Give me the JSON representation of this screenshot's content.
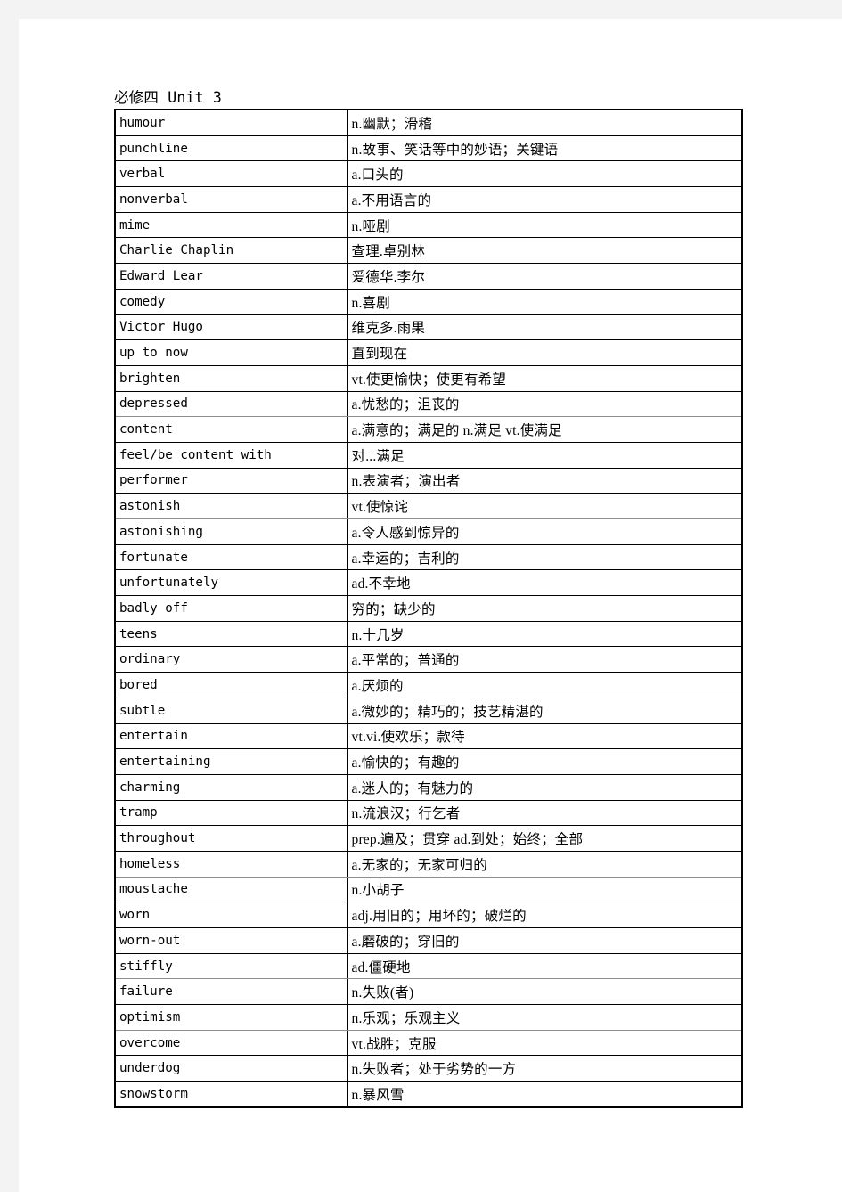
{
  "document": {
    "title": "必修四 Unit 3",
    "page_background": "#ffffff",
    "margin_background": "#f3f3f4",
    "text_color": "#000000",
    "border_color": "#000000"
  },
  "table": {
    "columns": [
      "word",
      "definition"
    ],
    "rows": [
      {
        "word": "humour",
        "definition": "n.幽默；滑稽"
      },
      {
        "word": "punchline",
        "definition": "n.故事、笑话等中的妙语；关键语"
      },
      {
        "word": "verbal",
        "definition": "a.口头的"
      },
      {
        "word": "nonverbal",
        "definition": "a.不用语言的"
      },
      {
        "word": "mime",
        "definition": "n.哑剧"
      },
      {
        "word": "Charlie Chaplin",
        "definition": "查理.卓别林"
      },
      {
        "word": "Edward Lear",
        "definition": "爱德华.李尔"
      },
      {
        "word": "comedy",
        "definition": "n.喜剧"
      },
      {
        "word": "Victor Hugo",
        "definition": "维克多.雨果"
      },
      {
        "word": "up to now",
        "definition": "直到现在"
      },
      {
        "word": "brighten",
        "definition": "vt.使更愉快；使更有希望"
      },
      {
        "word": "depressed",
        "definition": "a.忧愁的；沮丧的"
      },
      {
        "word": "content",
        "definition": "a.满意的；满足的 n.满足 vt.使满足"
      },
      {
        "word": "feel/be content with",
        "definition": "对...满足"
      },
      {
        "word": "performer",
        "definition": "n.表演者；演出者"
      },
      {
        "word": "astonish",
        "definition": "vt.使惊诧"
      },
      {
        "word": "astonishing",
        "definition": "a.令人感到惊异的"
      },
      {
        "word": "fortunate",
        "definition": "a.幸运的；吉利的"
      },
      {
        "word": "unfortunately",
        "definition": "ad.不幸地"
      },
      {
        "word": "badly off",
        "definition": "穷的；缺少的"
      },
      {
        "word": "teens",
        "definition": "n.十几岁"
      },
      {
        "word": "ordinary",
        "definition": "a.平常的；普通的"
      },
      {
        "word": "bored",
        "definition": "a.厌烦的"
      },
      {
        "word": "subtle",
        "definition": "a.微妙的；精巧的；技艺精湛的"
      },
      {
        "word": "entertain",
        "definition": "vt.vi.使欢乐；款待"
      },
      {
        "word": "entertaining",
        "definition": "a.愉快的；有趣的"
      },
      {
        "word": "charming",
        "definition": "a.迷人的；有魅力的"
      },
      {
        "word": "tramp",
        "definition": "n.流浪汉；行乞者"
      },
      {
        "word": "throughout",
        "definition": "prep.遍及；贯穿 ad.到处；始终；全部"
      },
      {
        "word": "homeless",
        "definition": "a.无家的；无家可归的"
      },
      {
        "word": "moustache",
        "definition": "n.小胡子"
      },
      {
        "word": "worn",
        "definition": "adj.用旧的；用坏的；破烂的"
      },
      {
        "word": "worn-out",
        "definition": "a.磨破的；穿旧的"
      },
      {
        "word": "stiffly",
        "definition": "ad.僵硬地"
      },
      {
        "word": "failure",
        "definition": "n.失败(者)"
      },
      {
        "word": "optimism",
        "definition": "n.乐观；乐观主义"
      },
      {
        "word": "overcome",
        "definition": "vt.战胜；克服"
      },
      {
        "word": "underdog",
        "definition": "n.失败者；处于劣势的一方"
      },
      {
        "word": "snowstorm",
        "definition": "n.暴风雪"
      }
    ]
  }
}
